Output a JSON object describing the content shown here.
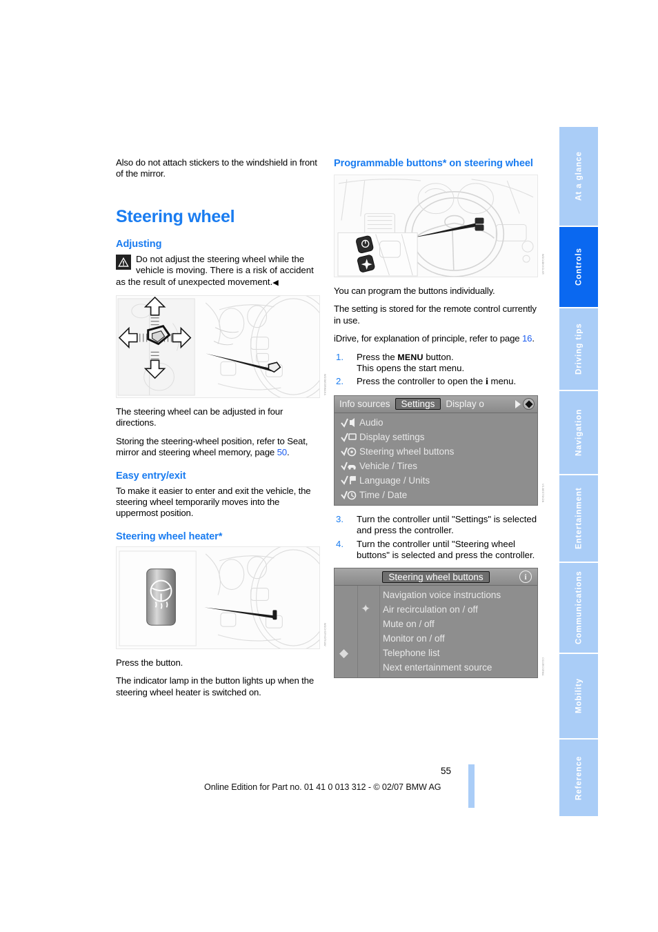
{
  "page": {
    "number": "55",
    "footer_text": "Online Edition for Part no. 01 41 0 013 312 - © 02/07 BMW AG",
    "accent_color": "#1a7cf0",
    "tab_color": "#aacdf7",
    "tab_active_color": "#0a68f0"
  },
  "sidebar": {
    "tabs": [
      {
        "label": "At a glance",
        "active": false
      },
      {
        "label": "Controls",
        "active": true
      },
      {
        "label": "Driving tips",
        "active": false
      },
      {
        "label": "Navigation",
        "active": false
      },
      {
        "label": "Entertainment",
        "active": false
      },
      {
        "label": "Communications",
        "active": false
      },
      {
        "label": "Mobility",
        "active": false
      },
      {
        "label": "Reference",
        "active": false
      }
    ]
  },
  "left_column": {
    "intro_paragraph": "Also do not attach stickers to the windshield in front of the mirror.",
    "section_title": "Steering wheel",
    "adjusting": {
      "heading": "Adjusting",
      "warning_text": "Do not adjust the steering wheel while the vehicle is moving. There is a risk of accident as the result of unexpected movement.",
      "warning_end_marker": "◀",
      "figure_caption_code": "WDSMS5RWAHA",
      "paragraph_1": "The steering wheel can be adjusted in four directions.",
      "paragraph_2_pre": "Storing the steering-wheel position, refer to Seat, mirror and steering wheel memory, page ",
      "paragraph_2_link": "50",
      "paragraph_2_post": "."
    },
    "easy_entry": {
      "heading": "Easy entry/exit",
      "paragraph": "To make it easier to enter and exit the vehicle, the steering wheel temporarily moves into the uppermost position."
    },
    "heater": {
      "heading": "Steering wheel heater*",
      "figure_caption_code": "WDCHSFHOTKAW",
      "paragraph_1": "Press the button.",
      "paragraph_2": "The indicator lamp in the button lights up when the steering wheel heater is switched on."
    }
  },
  "right_column": {
    "heading": "Programmable buttons* on steering wheel",
    "figure_caption_code": "WDCABKKCLKR",
    "paragraph_1": "You can program the buttons individually.",
    "paragraph_2": "The setting is stored for the remote control currently in use.",
    "paragraph_3_pre": "iDrive, for explanation of principle, refer to page ",
    "paragraph_3_link": "16",
    "paragraph_3_post": ".",
    "steps": [
      {
        "num": "1.",
        "line1_pre": "Press the ",
        "line1_kbd": "MENU",
        "line1_post": " button.",
        "line2": "This opens the start menu."
      },
      {
        "num": "2.",
        "line1_pre": "Press the controller to open the ",
        "line1_kbd": "i",
        "line1_post": " menu.",
        "line2": ""
      },
      {
        "num": "3.",
        "line1_pre": "Turn the controller until \"Settings\" is selected and press the controller.",
        "line1_kbd": "",
        "line1_post": "",
        "line2": ""
      },
      {
        "num": "4.",
        "line1_pre": "Turn the controller until \"Steering wheel buttons\" is selected and press the controller.",
        "line1_kbd": "",
        "line1_post": "",
        "line2": ""
      }
    ],
    "idrive_settings_screen": {
      "caption_code": "VS-BESTSKDN",
      "tabs": [
        {
          "label": "Info sources",
          "selected": false
        },
        {
          "label": "Settings",
          "selected": true
        },
        {
          "label": "Display o",
          "selected": false
        }
      ],
      "items": [
        {
          "label": "Audio",
          "icon": "check-speaker-icon"
        },
        {
          "label": "Display settings",
          "icon": "check-screen-icon"
        },
        {
          "label": "Steering wheel buttons",
          "icon": "check-wheel-icon"
        },
        {
          "label": "Vehicle / Tires",
          "icon": "check-car-icon"
        },
        {
          "label": "Language / Units",
          "icon": "check-flag-icon"
        },
        {
          "label": "Time / Date",
          "icon": "check-clock-icon"
        }
      ]
    },
    "idrive_buttons_screen": {
      "caption_code": "CS10RCSRMA",
      "title": "Steering wheel buttons",
      "items": [
        {
          "label": "Navigation voice instructions"
        },
        {
          "label": "Air recirculation on / off"
        },
        {
          "label": "Mute on / off"
        },
        {
          "label": "Monitor on / off"
        },
        {
          "label": "Telephone list"
        },
        {
          "label": "Next entertainment source"
        }
      ]
    }
  }
}
